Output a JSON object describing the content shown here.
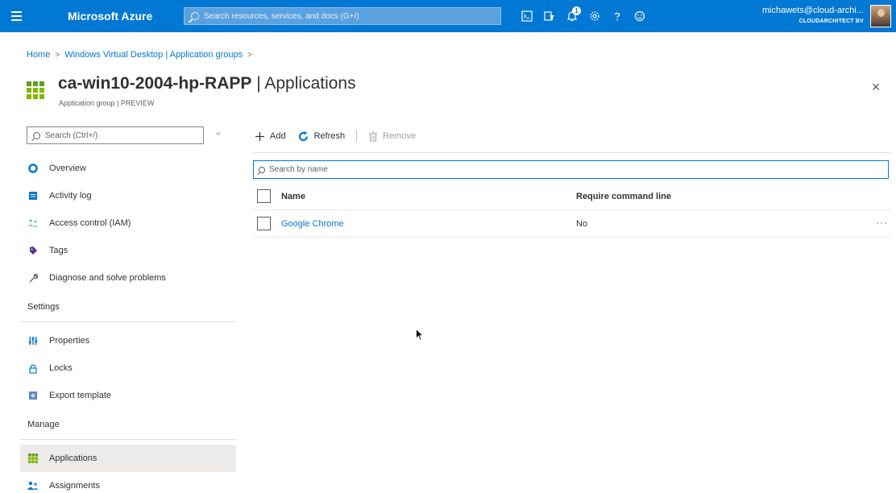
{
  "topbar": {
    "brand": "Microsoft Azure",
    "search_placeholder": "Search resources, services, and docs (G+/)",
    "notification_count": "1",
    "account_name": "michawets@cloud-archi...",
    "account_org": "CLOUDARCHITECT BV",
    "accent_color": "#0078d4"
  },
  "breadcrumb": {
    "items": [
      "Home",
      "Windows Virtual Desktop | Application groups"
    ],
    "separator": ">"
  },
  "header": {
    "resource_name": "ca-win10-2004-hp-RAPP",
    "divider": " | ",
    "section": "Applications",
    "subtitle": "Application group | PREVIEW",
    "close": "×"
  },
  "nav": {
    "search_placeholder": "Search (Ctrl+/)",
    "collapse": "«",
    "items": [
      {
        "label": "Overview",
        "icon": "overview-icon"
      },
      {
        "label": "Activity log",
        "icon": "activity-log-icon"
      },
      {
        "label": "Access control (IAM)",
        "icon": "people-icon"
      },
      {
        "label": "Tags",
        "icon": "tag-icon"
      },
      {
        "label": "Diagnose and solve problems",
        "icon": "wrench-icon"
      }
    ],
    "sections": [
      {
        "title": "Settings",
        "items": [
          {
            "label": "Properties",
            "icon": "properties-icon"
          },
          {
            "label": "Locks",
            "icon": "lock-icon"
          },
          {
            "label": "Export template",
            "icon": "export-icon"
          }
        ]
      },
      {
        "title": "Manage",
        "items": [
          {
            "label": "Applications",
            "icon": "applications-icon",
            "active": true
          },
          {
            "label": "Assignments",
            "icon": "assignments-icon"
          }
        ]
      }
    ]
  },
  "toolbar": {
    "add": "Add",
    "refresh": "Refresh",
    "remove": "Remove"
  },
  "grid": {
    "filter_placeholder": "Search by name",
    "columns": [
      "Name",
      "Require command line"
    ],
    "rows": [
      {
        "name": "Google Chrome",
        "require_command_line": "No",
        "more": "···"
      }
    ]
  }
}
